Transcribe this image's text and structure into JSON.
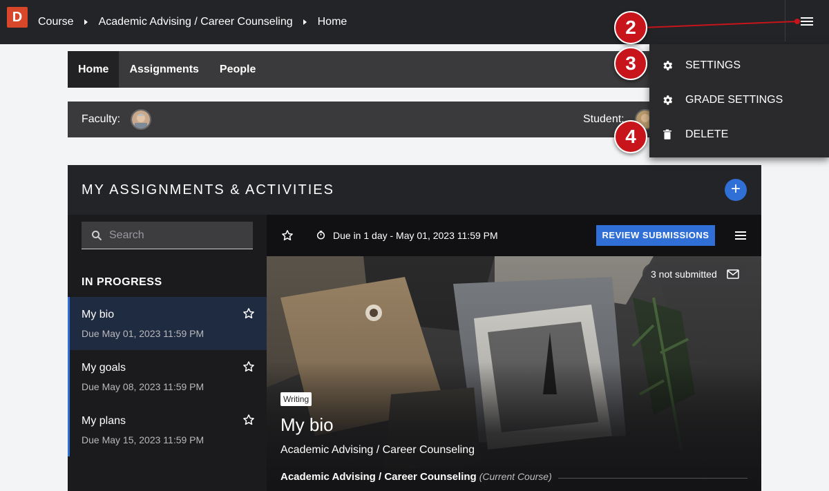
{
  "app": {
    "logo_letter": "D",
    "brand_color": "#d9472b",
    "accent_color": "#2f6fd6",
    "step_marker_color": "#c8141b"
  },
  "breadcrumb": [
    "Course",
    "Academic Advising / Career Counseling",
    "Home"
  ],
  "course_nav": {
    "tabs": [
      {
        "label": "Home",
        "active": true
      },
      {
        "label": "Assignments",
        "active": false
      },
      {
        "label": "People",
        "active": false
      }
    ]
  },
  "members": {
    "faculty_label": "Faculty:",
    "student_label": "Student:"
  },
  "dropdown_menu": {
    "items": [
      {
        "label": "SETTINGS",
        "icon": "gear-icon"
      },
      {
        "label": "GRADE SETTINGS",
        "icon": "gear-icon"
      },
      {
        "label": "DELETE",
        "icon": "trash-icon"
      }
    ]
  },
  "step_markers": [
    "2",
    "3",
    "4"
  ],
  "assignments": {
    "title": "MY ASSIGNMENTS & ACTIVITIES",
    "add_icon": "plus-icon",
    "search_placeholder": "Search",
    "section_heading": "IN PROGRESS",
    "items": [
      {
        "title": "My bio",
        "due": "Due May 01, 2023 11:59 PM",
        "active": true
      },
      {
        "title": "My goals",
        "due": "Due May 08, 2023 11:59 PM",
        "active": false
      },
      {
        "title": "My plans",
        "due": "Due May 15, 2023 11:59 PM",
        "active": false
      }
    ],
    "detail": {
      "due_text": "Due in 1 day - May 01, 2023 11:59 PM",
      "review_button": "REVIEW SUBMISSIONS",
      "not_submitted": "3 not submitted",
      "tag": "Writing",
      "title": "My bio",
      "subtitle": "Academic Advising / Career Counseling",
      "course_name": "Academic Advising / Career Counseling",
      "course_note": "(Current Course)"
    }
  }
}
